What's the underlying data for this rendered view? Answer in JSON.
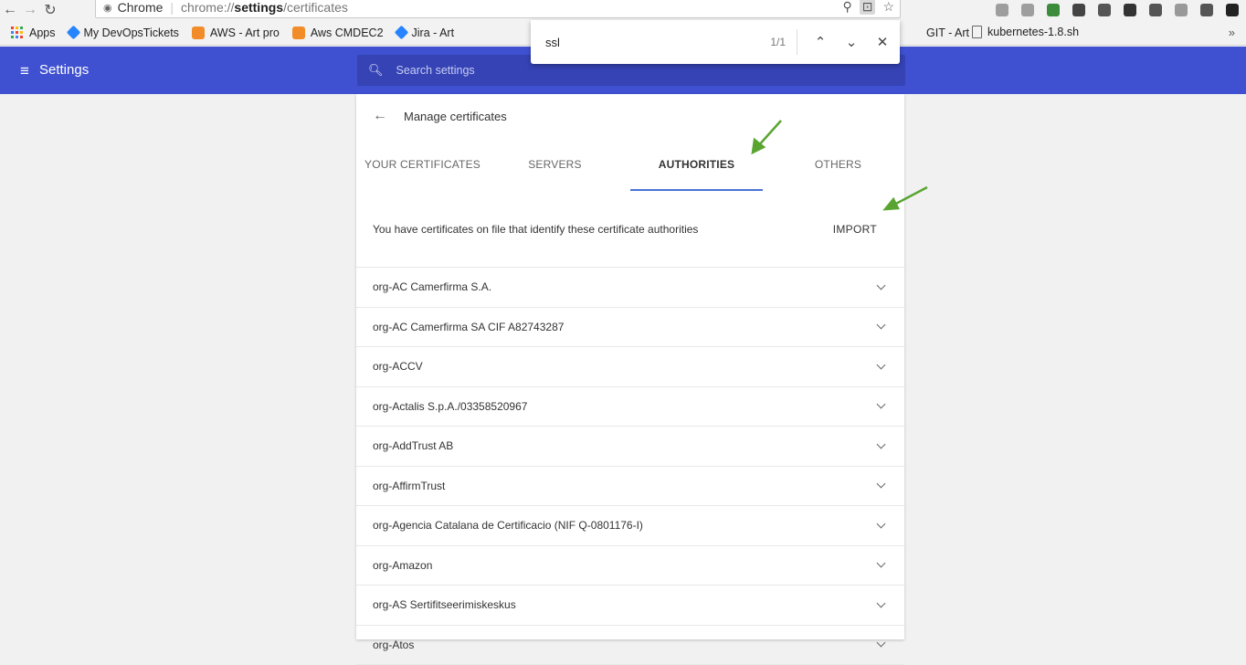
{
  "browser": {
    "site_chip": "Chrome",
    "url_scheme": "chrome://",
    "url_host": "settings",
    "url_path": "/certificates",
    "extension_colors": [
      "#9e9e9e",
      "#9e9e9e",
      "#3d8b3d",
      "#444444",
      "#555555",
      "#333333",
      "#555555",
      "#999999",
      "#555555",
      "#222222"
    ]
  },
  "bookmarks": {
    "items": [
      {
        "label": "Apps",
        "icon": "apps-grid-icon"
      },
      {
        "label": "My DevOpsTickets",
        "icon": "jira-diamond-icon"
      },
      {
        "label": "AWS - Art pro",
        "icon": "aws-cube-icon"
      },
      {
        "label": "Aws CMDEC2",
        "icon": "aws-cube-icon"
      },
      {
        "label": "Jira - Art",
        "icon": "jira-diamond-icon"
      }
    ],
    "right_items": [
      {
        "label": "GIT - Art",
        "icon": ""
      },
      {
        "label": "kubernetes-1.8.sh",
        "icon": "document-icon"
      }
    ],
    "more": "»"
  },
  "findbar": {
    "query": "ssl",
    "count": "1/1"
  },
  "settings": {
    "menu_icon": "≡",
    "title": "Settings",
    "search_placeholder": "Search settings"
  },
  "certificates": {
    "heading": "Manage certificates",
    "tabs": [
      {
        "label": "YOUR CERTIFICATES",
        "active": false
      },
      {
        "label": "SERVERS",
        "active": false
      },
      {
        "label": "AUTHORITIES",
        "active": true
      },
      {
        "label": "OTHERS",
        "active": false
      }
    ],
    "description": "You have certificates on file that identify these certificate authorities",
    "import_label": "IMPORT",
    "authorities": [
      "org-AC Camerfirma S.A.",
      "org-AC Camerfirma SA CIF A82743287",
      "org-ACCV",
      "org-Actalis S.p.A./03358520967",
      "org-AddTrust AB",
      "org-AffirmTrust",
      "org-Agencia Catalana de Certificacio (NIF Q-0801176-I)",
      "org-Amazon",
      "org-AS Sertifitseerimiskeskus",
      "org-Atos"
    ]
  },
  "colors": {
    "header": "#3f51d1",
    "search": "#3543b5",
    "tab_underline": "#4a73d9",
    "annotation_arrow": "#5aa532"
  }
}
